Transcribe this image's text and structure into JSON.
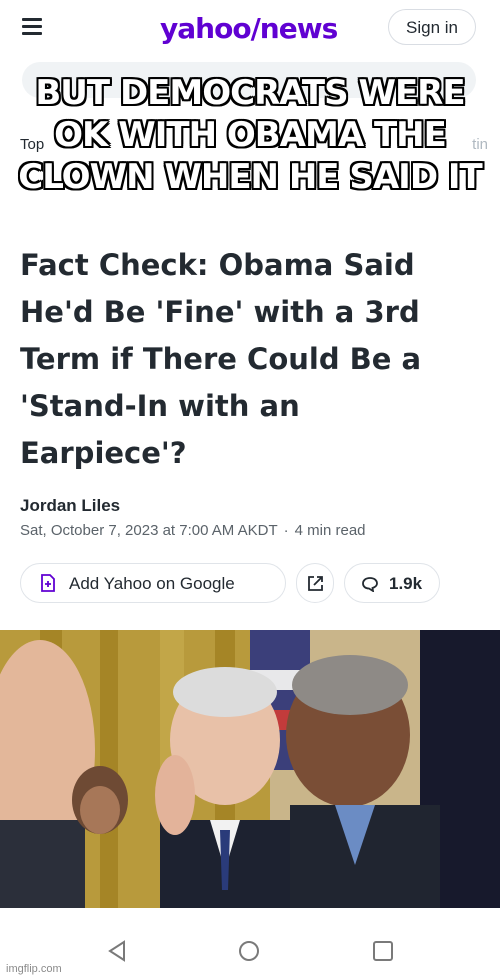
{
  "header": {
    "logo_yahoo": "yahoo",
    "logo_slash": "/",
    "logo_news": "news",
    "signin_label": "Sign in"
  },
  "tabs": {
    "left_partial": "Top",
    "right_partial": "tin"
  },
  "meme_caption": {
    "line1": "BUT DEMOCRATS WERE",
    "line2": "OK WITH OBAMA THE",
    "line3": "CLOWN WHEN HE SAID IT"
  },
  "article": {
    "headline_lines": [
      "Fact Check: Obama Said",
      "He'd Be 'Fine' with a 3rd",
      "Term if There Could Be a",
      "'Stand-In with an",
      "Earpiece'?"
    ],
    "author": "Jordan Liles",
    "date": "Sat, October 7, 2023 at 7:00 AM AKDT",
    "separator": "·",
    "read_time": "4 min read"
  },
  "actions": {
    "add_google_label": "Add Yahoo on Google",
    "comments_count": "1.9k"
  },
  "watermark": "imgflip.com",
  "colors": {
    "brand": "#6001d2",
    "text": "#232a31",
    "muted": "#5b636a"
  }
}
